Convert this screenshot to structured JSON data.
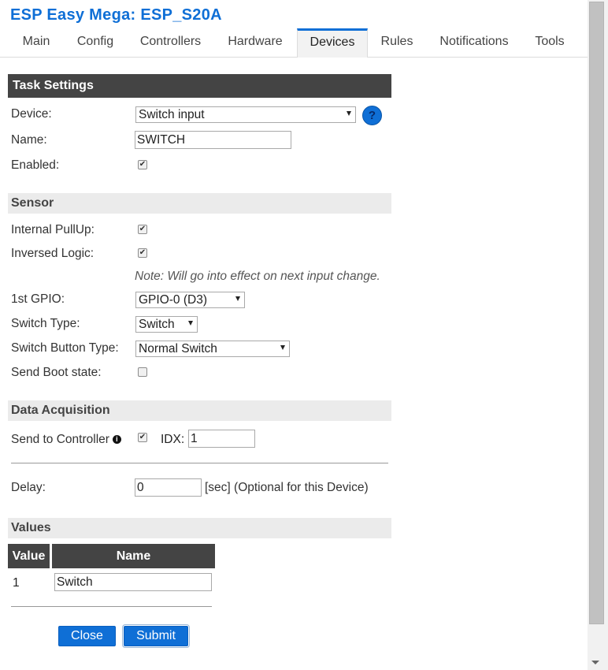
{
  "app": {
    "title": "ESP Easy Mega: ESP_S20A"
  },
  "tabs": [
    {
      "label": "Main",
      "active": false
    },
    {
      "label": "Config",
      "active": false
    },
    {
      "label": "Controllers",
      "active": false
    },
    {
      "label": "Hardware",
      "active": false
    },
    {
      "label": "Devices",
      "active": true
    },
    {
      "label": "Rules",
      "active": false
    },
    {
      "label": "Notifications",
      "active": false
    },
    {
      "label": "Tools",
      "active": false
    }
  ],
  "task": {
    "header": "Task Settings",
    "device_label": "Device:",
    "device_value": "Switch input",
    "help_icon": "?",
    "name_label": "Name:",
    "name_value": "SWITCH",
    "enabled_label": "Enabled:",
    "enabled_checked": true
  },
  "sensor": {
    "header": "Sensor",
    "pullup_label": "Internal PullUp:",
    "pullup_checked": true,
    "inversed_label": "Inversed Logic:",
    "inversed_checked": true,
    "note": "Note: Will go into effect on next input change.",
    "gpio_label": "1st GPIO:",
    "gpio_value": "GPIO-0 (D3)",
    "switch_type_label": "Switch Type:",
    "switch_type_value": "Switch",
    "button_type_label": "Switch Button Type:",
    "button_type_value": "Normal Switch",
    "boot_state_label": "Send Boot state:",
    "boot_state_checked": false
  },
  "acquisition": {
    "header": "Data Acquisition",
    "send_label": "Send to Controller",
    "send_info_icon": "i",
    "send_checked": true,
    "idx_label": "IDX:",
    "idx_value": "1",
    "delay_label": "Delay:",
    "delay_value": "0",
    "delay_suffix": "[sec] (Optional for this Device)"
  },
  "values": {
    "header": "Values",
    "col_value": "Value",
    "col_name": "Name",
    "rows": [
      {
        "value": "1",
        "name": "Switch"
      }
    ]
  },
  "buttons": {
    "close": "Close",
    "submit": "Submit"
  },
  "colors": {
    "accent": "#0f6fd6",
    "header_dark": "#444444",
    "header_light": "#ebebeb"
  },
  "icons": {
    "check": "✔"
  }
}
